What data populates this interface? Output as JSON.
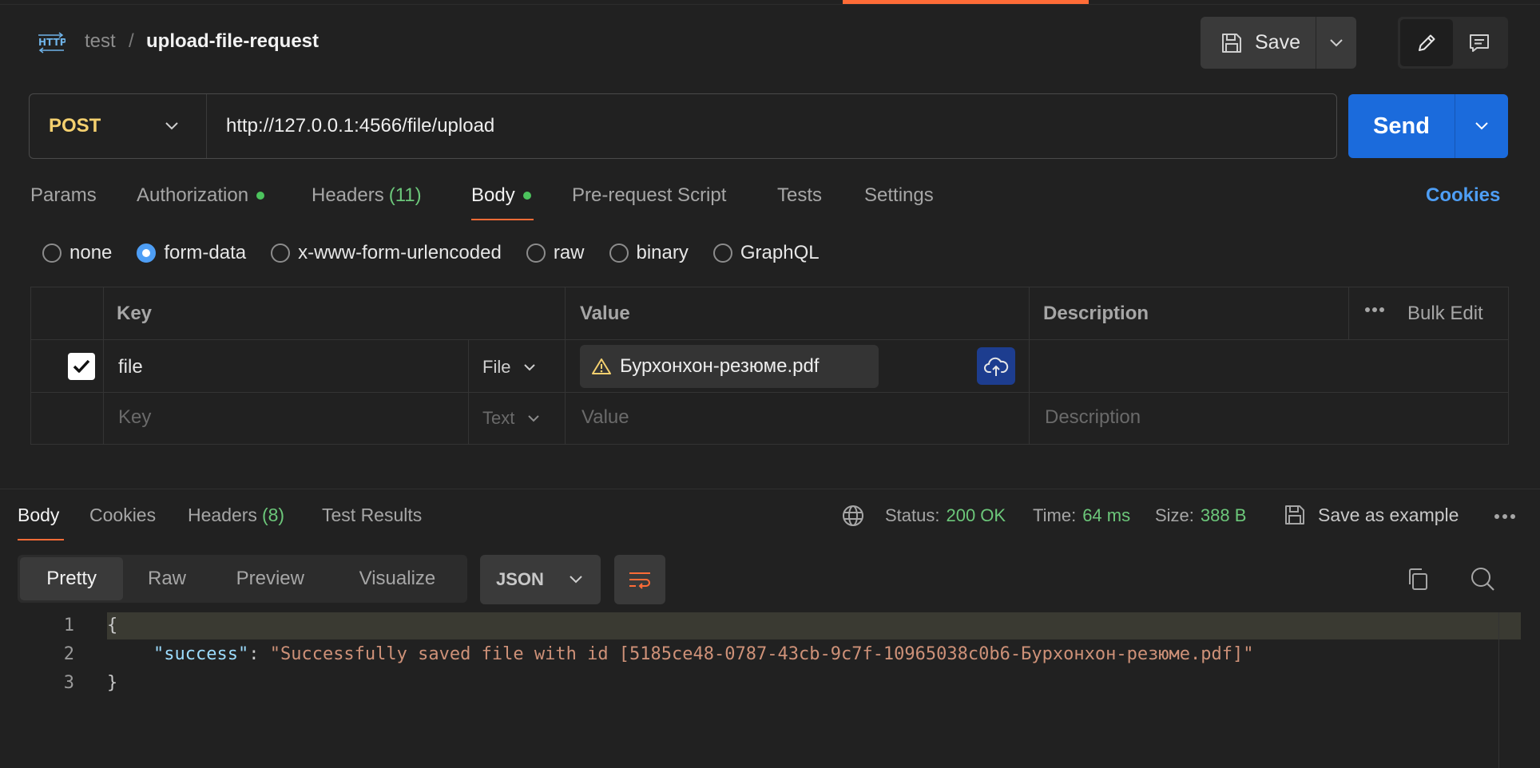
{
  "header": {
    "request_icon": "http-icon",
    "breadcrumb_collection": "test",
    "breadcrumb_separator": "/",
    "request_name": "upload-file-request",
    "save_label": "Save"
  },
  "request": {
    "method": "POST",
    "method_color": "#f4d06f",
    "url": "http://127.0.0.1:4566/file/upload",
    "send_label": "Send",
    "send_color": "#1b6bdc"
  },
  "tabs": {
    "params": "Params",
    "authorization": "Authorization",
    "headers": "Headers",
    "headers_count": "(11)",
    "body": "Body",
    "prerequest": "Pre-request Script",
    "tests": "Tests",
    "settings": "Settings",
    "cookies": "Cookies"
  },
  "body_types": {
    "none": "none",
    "form_data": "form-data",
    "urlencoded": "x-www-form-urlencoded",
    "raw": "raw",
    "binary": "binary",
    "graphql": "GraphQL",
    "selected": "form-data"
  },
  "form_table": {
    "headers": {
      "key": "Key",
      "value": "Value",
      "description": "Description",
      "bulk_edit": "Bulk Edit"
    },
    "rows": [
      {
        "checked": true,
        "key": "file",
        "type": "File",
        "value": "Бурхонхон-резюме.pdf",
        "description": ""
      }
    ],
    "placeholder": {
      "key": "Key",
      "type": "Text",
      "value": "Value",
      "description": "Description"
    }
  },
  "response": {
    "tabs": {
      "body": "Body",
      "cookies": "Cookies",
      "headers": "Headers",
      "headers_count": "(8)",
      "test_results": "Test Results"
    },
    "status_label": "Status:",
    "status": "200 OK",
    "time_label": "Time:",
    "time": "64 ms",
    "size_label": "Size:",
    "size": "388 B",
    "save_example": "Save as example",
    "views": {
      "pretty": "Pretty",
      "raw": "Raw",
      "preview": "Preview",
      "visualize": "Visualize"
    },
    "format": "JSON",
    "code": {
      "line1": "{",
      "line2_key": "\"success\"",
      "line2_sep": ": ",
      "line2_value": "\"Successfully saved file with id [5185ce48-0787-43cb-9c7f-10965038c0b6-Бурхонхон-резюме.pdf]\"",
      "line3": "}"
    }
  },
  "colors": {
    "accent": "#ff6c37",
    "success": "#6cc77a",
    "link": "#4e9ef5"
  }
}
